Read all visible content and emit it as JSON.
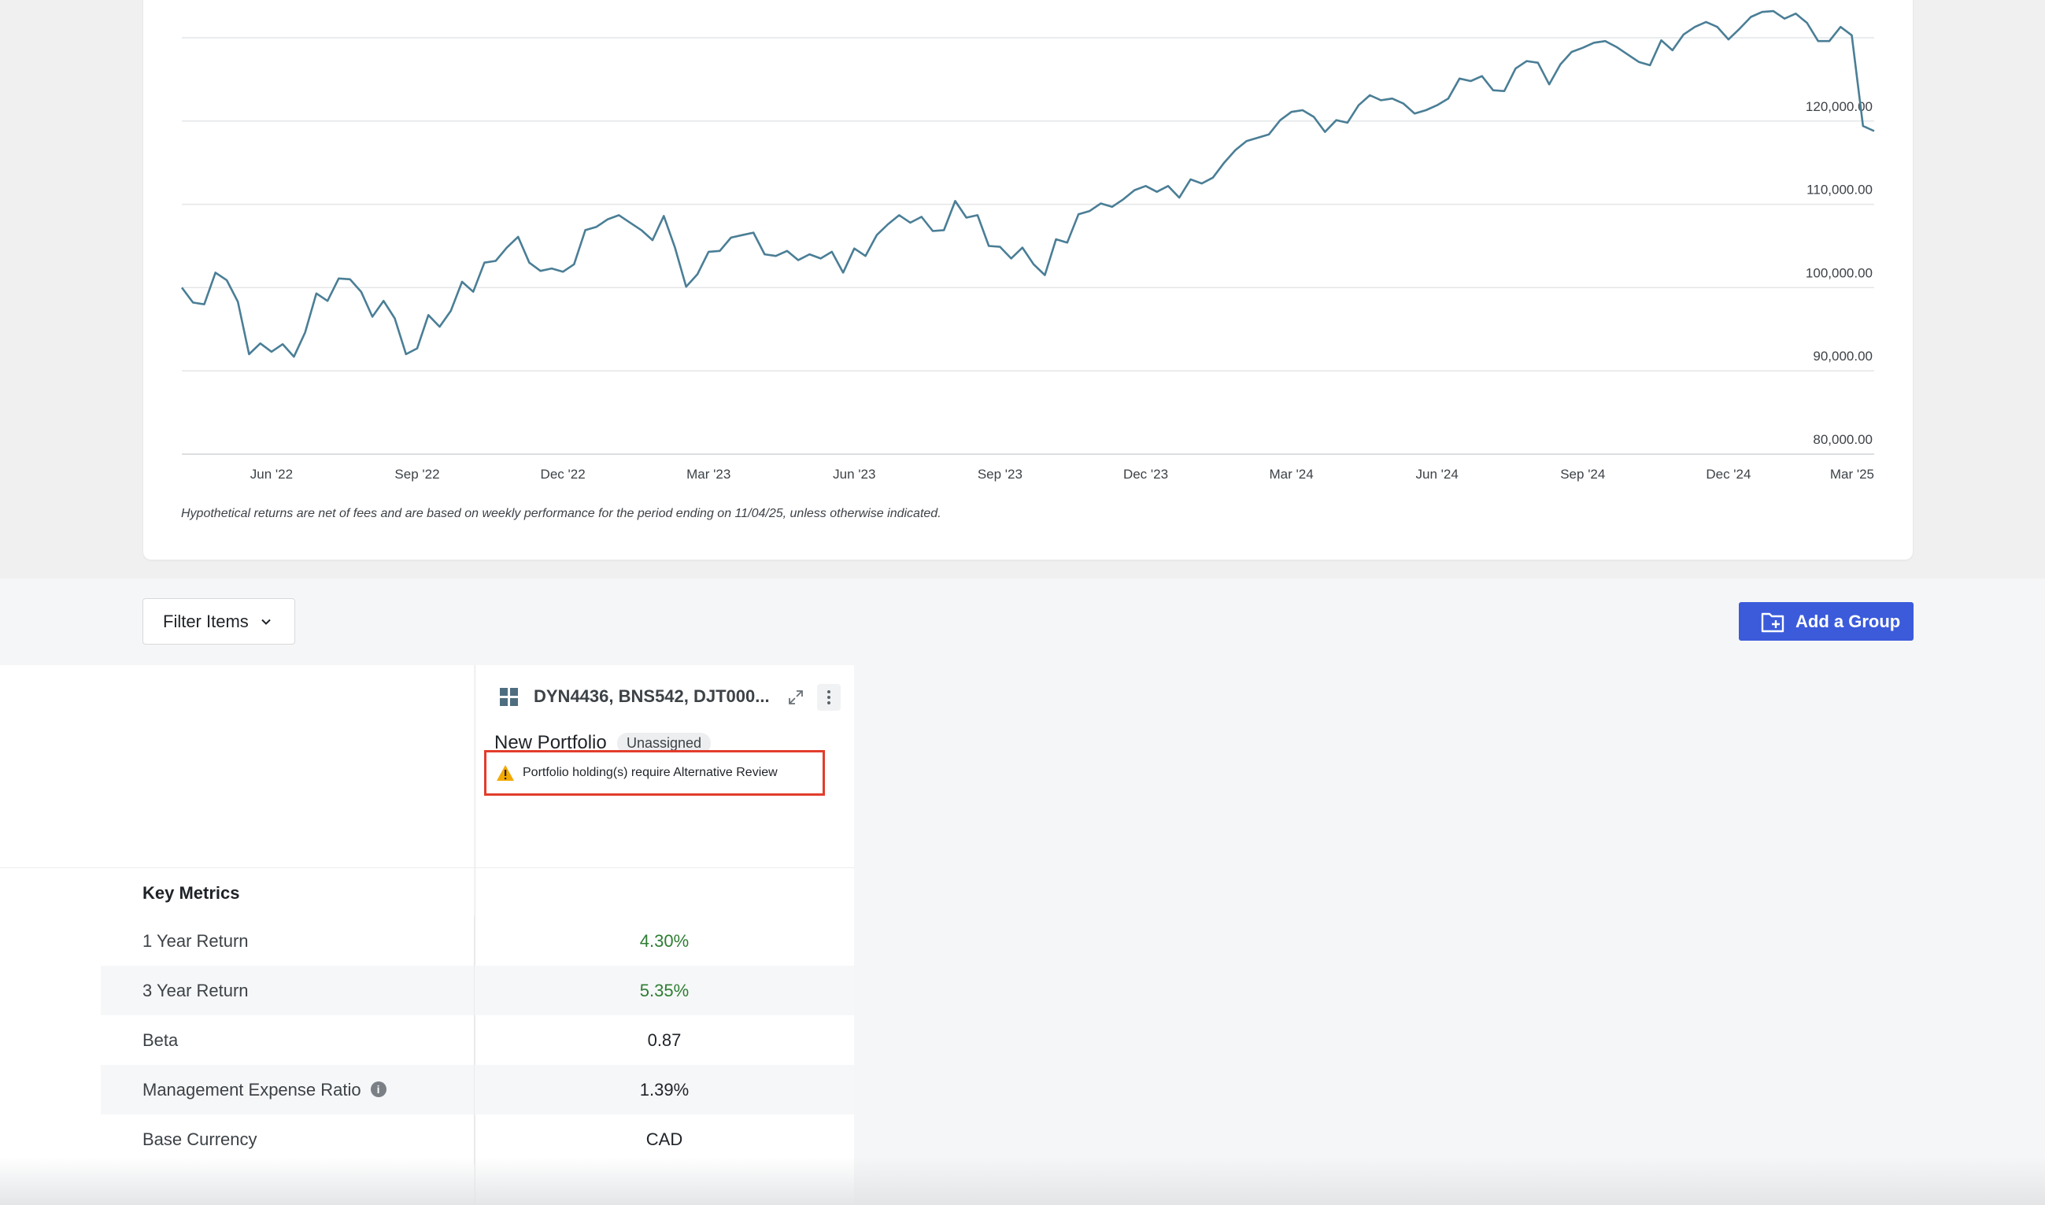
{
  "chart_data": {
    "type": "line",
    "ylim": [
      80000,
      130000
    ],
    "y_ticks": [
      "80,000.00",
      "90,000.00",
      "100,000.00",
      "110,000.00",
      "120,000.00"
    ],
    "y_tick_values": [
      80000,
      90000,
      100000,
      110000,
      120000
    ],
    "x_ticks": [
      "Jun '22",
      "Sep '22",
      "Dec '22",
      "Mar '23",
      "Jun '23",
      "Sep '23",
      "Dec '23",
      "Mar '24",
      "Jun '24",
      "Sep '24",
      "Dec '24",
      "Mar '25"
    ],
    "x_tick_positions": [
      8,
      21,
      34,
      47,
      60,
      73,
      86,
      99,
      112,
      125,
      138,
      151
    ],
    "grid": true,
    "line_color": "#4a7e96",
    "series": [
      {
        "values": [
          100000,
          98200,
          98000,
          101800,
          100900,
          98300,
          92000,
          93300,
          92300,
          93200,
          91700,
          94600,
          99300,
          98400,
          101100,
          101000,
          99500,
          96500,
          98400,
          96300,
          92000,
          92700,
          96700,
          95300,
          97200,
          100700,
          99500,
          103000,
          103200,
          104800,
          106100,
          103000,
          102000,
          102300,
          101900,
          102800,
          106900,
          107300,
          108200,
          108700,
          107800,
          106900,
          105700,
          108600,
          104800,
          100100,
          101600,
          104300,
          104400,
          106000,
          106300,
          106600,
          104000,
          103800,
          104400,
          103300,
          104000,
          103500,
          104300,
          101800,
          104700,
          103800,
          106300,
          107600,
          108700,
          107800,
          108500,
          106800,
          106900,
          110400,
          108400,
          108700,
          105000,
          104900,
          103500,
          104800,
          102800,
          101500,
          105800,
          105400,
          108800,
          109200,
          110100,
          109700,
          110600,
          111700,
          112200,
          111500,
          112200,
          110800,
          113000,
          112500,
          113200,
          115000,
          116500,
          117600,
          118000,
          118400,
          120100,
          121100,
          121300,
          120500,
          118700,
          120100,
          119800,
          121900,
          123100,
          122500,
          122700,
          122100,
          120900,
          121300,
          121900,
          122700,
          125100,
          124800,
          125400,
          123700,
          123600,
          126300,
          127200,
          127000,
          124400,
          126800,
          128300,
          128800,
          129400,
          129600,
          128900,
          128000,
          127100,
          126700,
          129700,
          128500,
          130400,
          131300,
          131900,
          131300,
          129800,
          131100,
          132500,
          133100,
          133200,
          132300,
          132900,
          131800,
          129600,
          129600,
          131300,
          130300,
          119400,
          118800
        ]
      }
    ]
  },
  "chart": {
    "disclaimer": "Hypothetical returns are net of fees and are based on weekly performance for the period ending on 11/04/25, unless otherwise indicated."
  },
  "toolbar": {
    "filter_label": "Filter Items",
    "add_group_label": "Add a Group"
  },
  "column": {
    "title": "DYN4436, BNS542, DJT000...",
    "portfolio_name": "New Portfolio",
    "badge": "Unassigned",
    "alert": "Portfolio holding(s) require Alternative Review"
  },
  "metrics": {
    "heading": "Key Metrics",
    "rows": [
      {
        "label": "1 Year Return",
        "value": "4.30%"
      },
      {
        "label": "3 Year Return",
        "value": "5.35%"
      },
      {
        "label": "Beta",
        "value": "0.87"
      },
      {
        "label": "Management Expense Ratio",
        "value": "1.39%"
      },
      {
        "label": "Base Currency",
        "value": "CAD"
      }
    ]
  },
  "colors": {
    "accent": "#3b5bdb",
    "positive": "#2e7d32",
    "alert_border": "#e23c2b",
    "warning": "#f2a900"
  }
}
